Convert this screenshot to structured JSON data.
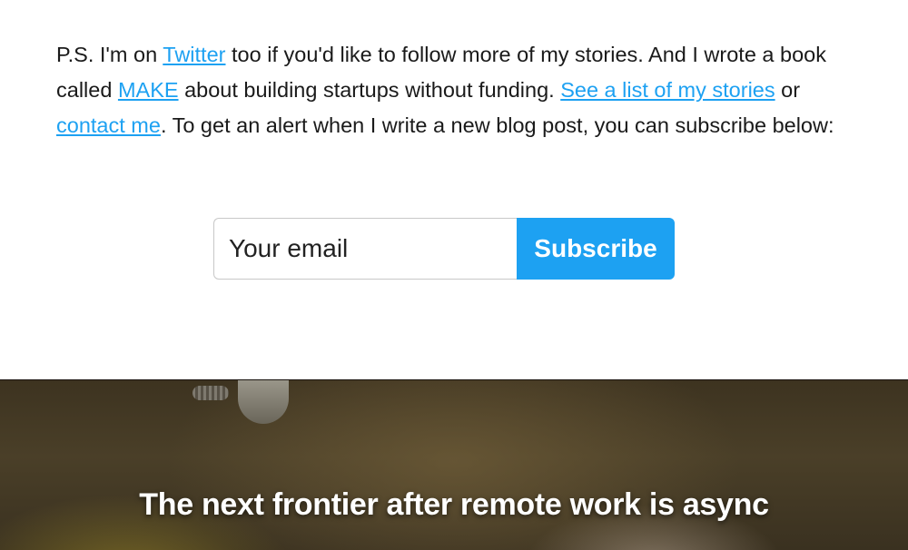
{
  "ps": {
    "t1": "P.S. I'm on ",
    "twitter_link": "Twitter",
    "t2": " too if you'd like to follow more of my stories. And I wrote a book called ",
    "make_link": "MAKE",
    "t3": " about building startups without funding. ",
    "stories_link": "See a list of my stories",
    "t4": " or ",
    "contact_link": "contact me",
    "t5": ". To get an alert when I write a new blog post, you can subscribe below:"
  },
  "subscribe_form": {
    "email_placeholder": "Your email",
    "button_label": "Subscribe"
  },
  "next_post": {
    "title": "The next frontier after remote work is async"
  },
  "colors": {
    "link": "#1da1f2",
    "button": "#1da1f2"
  }
}
